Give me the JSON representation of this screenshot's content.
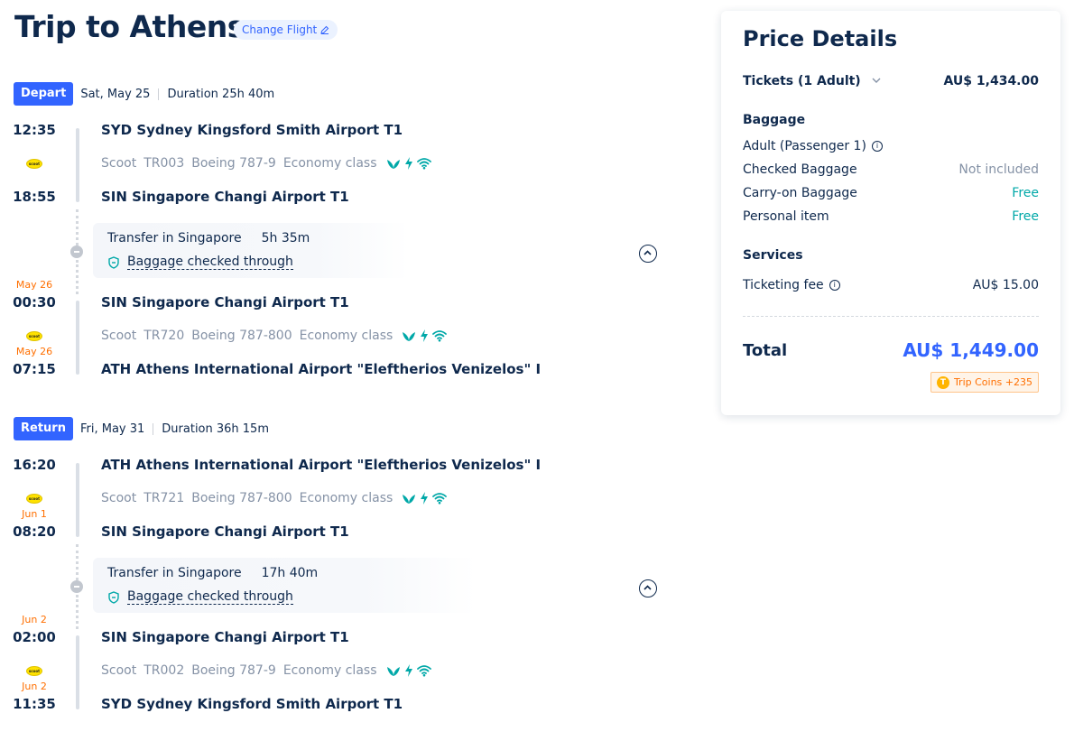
{
  "header": {
    "title": "Trip to Athens",
    "change_flight": "Change Flight"
  },
  "depart": {
    "badge": "Depart",
    "date": "Sat, May 25",
    "duration": "Duration 25h 40m",
    "seg1": {
      "dep_time": "12:35",
      "dep_airport": "SYD Sydney Kingsford Smith Airport T1",
      "airline": "Scoot",
      "flight_no": "TR003",
      "aircraft": "Boeing 787-9",
      "cabin": "Economy class",
      "arr_time": "18:55",
      "arr_airport": "SIN Singapore Changi Airport T1"
    },
    "transfer": {
      "label": "Transfer in Singapore",
      "duration": "5h 35m",
      "baggage": "Baggage checked through"
    },
    "seg2": {
      "dep_date": "May 26",
      "dep_time": "00:30",
      "dep_airport": "SIN Singapore Changi Airport T1",
      "airline": "Scoot",
      "flight_no": "TR720",
      "aircraft": "Boeing 787-800",
      "cabin": "Economy class",
      "arr_date": "May 26",
      "arr_time": "07:15",
      "arr_airport": "ATH Athens International Airport \"Eleftherios Venizelos\" I"
    }
  },
  "return": {
    "badge": "Return",
    "date": "Fri, May 31",
    "duration": "Duration 36h 15m",
    "seg1": {
      "dep_time": "16:20",
      "dep_airport": "ATH Athens International Airport \"Eleftherios Venizelos\" I",
      "airline": "Scoot",
      "flight_no": "TR721",
      "aircraft": "Boeing 787-800",
      "cabin": "Economy class",
      "arr_date": "Jun 1",
      "arr_time": "08:20",
      "arr_airport": "SIN Singapore Changi Airport T1"
    },
    "transfer": {
      "label": "Transfer in Singapore",
      "duration": "17h 40m",
      "baggage": "Baggage checked through"
    },
    "seg2": {
      "dep_date": "Jun 2",
      "dep_time": "02:00",
      "dep_airport": "SIN Singapore Changi Airport T1",
      "airline": "Scoot",
      "flight_no": "TR002",
      "aircraft": "Boeing 787-9",
      "cabin": "Economy class",
      "arr_date": "Jun 2",
      "arr_time": "11:35",
      "arr_airport": "SYD Sydney Kingsford Smith Airport T1"
    }
  },
  "airline_logo": "scoot",
  "price": {
    "title": "Price Details",
    "tickets_label": "Tickets (1 Adult)",
    "tickets_value": "AU$ 1,434.00",
    "baggage_title": "Baggage",
    "passenger": "Adult (Passenger 1)",
    "checked_label": "Checked Baggage",
    "checked_value": "Not included",
    "carry_label": "Carry-on Baggage",
    "carry_value": "Free",
    "personal_label": "Personal item",
    "personal_value": "Free",
    "services_title": "Services",
    "fee_label": "Ticketing fee",
    "fee_value": "AU$ 15.00",
    "total_label": "Total",
    "total_value": "AU$ 1,449.00",
    "coins": "Trip Coins +235"
  },
  "colors": {
    "accent": "#3264ff",
    "orange": "#ff6f00",
    "teal": "#00a8a8",
    "text": "#0f294d",
    "muted": "#8592a6"
  }
}
